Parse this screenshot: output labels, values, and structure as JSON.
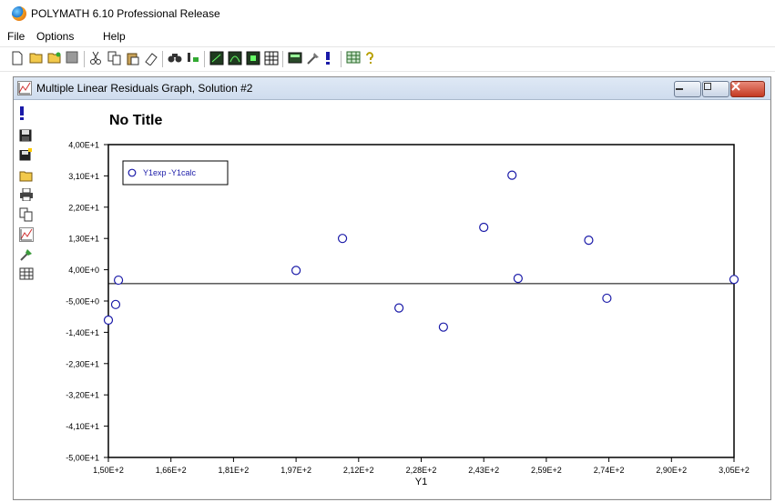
{
  "app": {
    "title": "POLYMATH 6.10 Professional Release"
  },
  "menu": {
    "items": [
      "File",
      "Options",
      "Help"
    ]
  },
  "toolbar": {
    "icons": [
      "new-icon",
      "open-icon",
      "open-example-icon",
      "save-icon",
      "cut-icon",
      "copy-icon",
      "paste-icon",
      "eraser-icon",
      "find-icon",
      "replace-icon",
      "linear-equations-icon",
      "nonlinear-equations-icon",
      "differential-equations-icon",
      "regression-icon",
      "calculator-icon",
      "tools-icon",
      "run-icon",
      "unit-converter-icon",
      "help-icon"
    ]
  },
  "window": {
    "title": "Multiple Linear Residuals Graph, Solution #2"
  },
  "side_tools": [
    "run-icon",
    "save-icon",
    "save-as-icon",
    "open-icon",
    "print-icon",
    "copy-icon",
    "graph-options-icon",
    "paint-icon",
    "table-icon"
  ],
  "chart_data": {
    "type": "scatter",
    "title": "No Title",
    "xlabel": "Y1",
    "ylabel": "",
    "xlim": [
      150,
      305
    ],
    "ylim": [
      -50,
      40
    ],
    "x_ticks": [
      "1,50E+2",
      "1,66E+2",
      "1,81E+2",
      "1,97E+2",
      "2,12E+2",
      "2,28E+2",
      "2,43E+2",
      "2,59E+2",
      "2,74E+2",
      "2,90E+2",
      "3,05E+2"
    ],
    "x_tick_values": [
      150,
      165.5,
      181,
      196.5,
      212,
      227.5,
      243,
      258.5,
      274,
      289.5,
      305
    ],
    "y_ticks": [
      "4,00E+1",
      "3,10E+1",
      "2,20E+1",
      "1,30E+1",
      "4,00E+0",
      "-5,00E+0",
      "-1,40E+1",
      "-2,30E+1",
      "-3,20E+1",
      "-4,10E+1",
      "-5,00E+1"
    ],
    "y_tick_values": [
      40,
      31,
      22,
      13,
      4,
      -5,
      -14,
      -23,
      -32,
      -41,
      -50
    ],
    "legend_position": "top-left",
    "zero_line": 0,
    "series": [
      {
        "name": "Y1exp -Y1calc",
        "color": "#1a1aa8",
        "x": [
          150,
          151.8,
          152.5,
          196.5,
          208,
          222,
          233,
          243,
          250,
          251.5,
          269,
          273.5,
          305
        ],
        "y": [
          -10.5,
          -6,
          1,
          3.8,
          13,
          -7,
          -12.5,
          16.2,
          31.2,
          1.5,
          12.5,
          -4.2,
          1.2
        ]
      }
    ]
  }
}
